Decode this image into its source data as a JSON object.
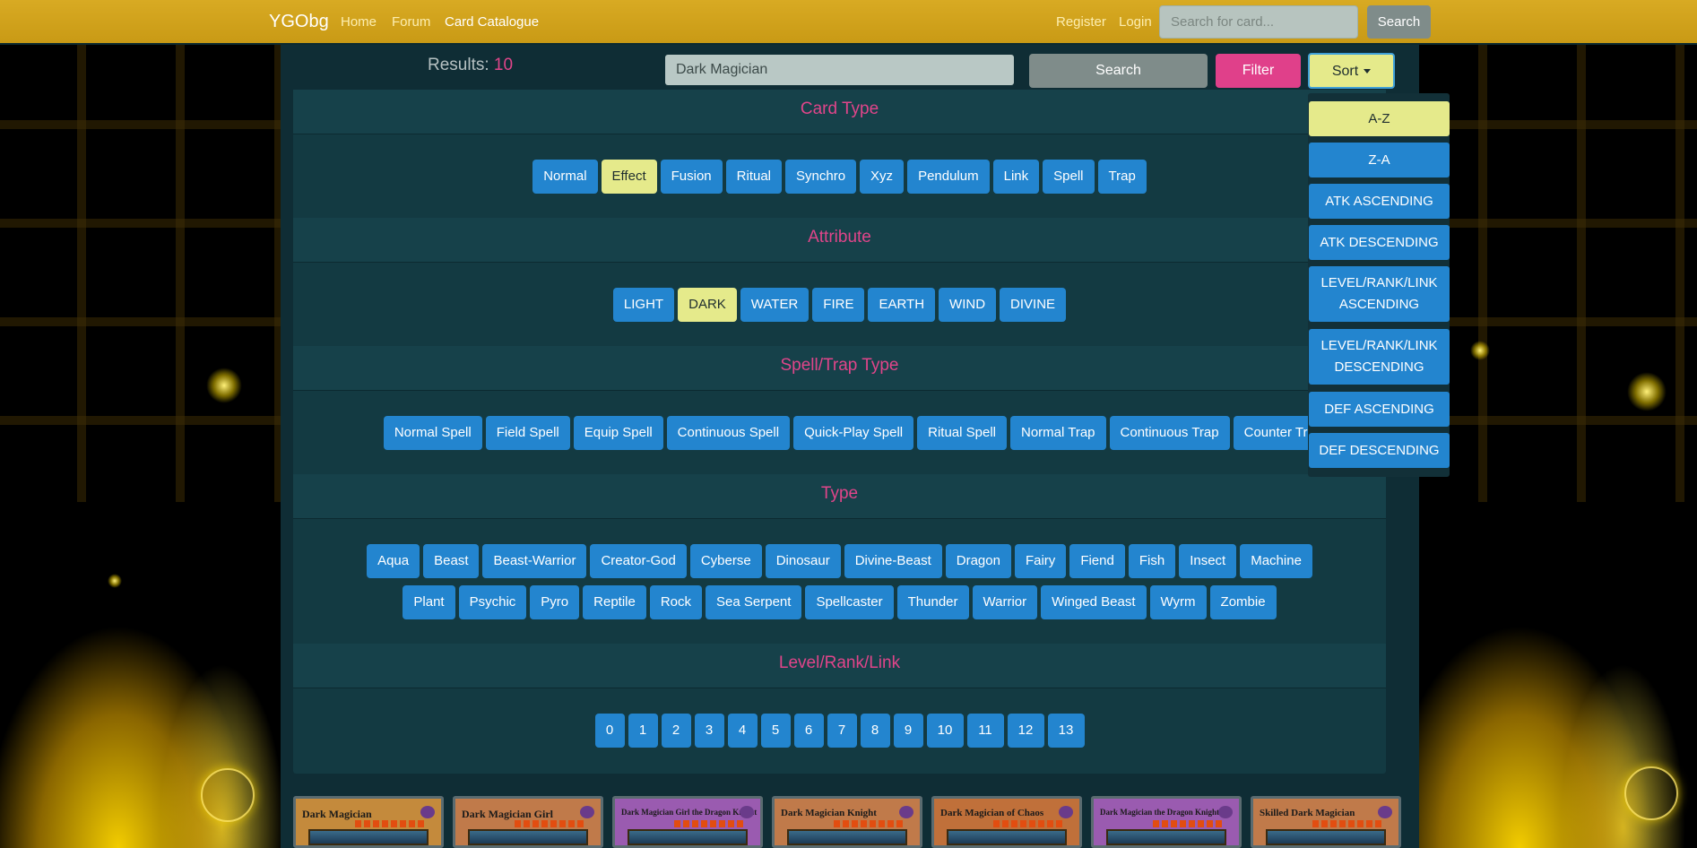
{
  "navbar": {
    "brand": "YGObg",
    "links": [
      "Home",
      "Forum",
      "Card Catalogue"
    ],
    "register": "Register",
    "login": "Login",
    "search_placeholder": "Search for card...",
    "search_button": "Search"
  },
  "toolbar": {
    "results_label": "Results:",
    "results_count": "10",
    "search_value": "Dark Magician",
    "search_button": "Search",
    "filter_button": "Filter",
    "sort_button": "Sort"
  },
  "filters": {
    "card_type": {
      "title": "Card Type",
      "options": [
        "Normal",
        "Effect",
        "Fusion",
        "Ritual",
        "Synchro",
        "Xyz",
        "Pendulum",
        "Link",
        "Spell",
        "Trap"
      ],
      "selected": "Effect"
    },
    "attribute": {
      "title": "Attribute",
      "options": [
        "LIGHT",
        "DARK",
        "WATER",
        "FIRE",
        "EARTH",
        "WIND",
        "DIVINE"
      ],
      "selected": "DARK"
    },
    "spell_trap_type": {
      "title": "Spell/Trap Type",
      "options": [
        "Normal Spell",
        "Field Spell",
        "Equip Spell",
        "Continuous Spell",
        "Quick-Play Spell",
        "Ritual Spell",
        "Normal Trap",
        "Continuous Trap",
        "Counter Trap"
      ]
    },
    "type": {
      "title": "Type",
      "row1": [
        "Aqua",
        "Beast",
        "Beast-Warrior",
        "Creator-God",
        "Cyberse",
        "Dinosaur",
        "Divine-Beast",
        "Dragon",
        "Fairy",
        "Fiend",
        "Fish",
        "Insect",
        "Machine"
      ],
      "row2": [
        "Plant",
        "Psychic",
        "Pyro",
        "Reptile",
        "Rock",
        "Sea Serpent",
        "Spellcaster",
        "Thunder",
        "Warrior",
        "Winged Beast",
        "Wyrm",
        "Zombie"
      ]
    },
    "level": {
      "title": "Level/Rank/Link",
      "options": [
        "0",
        "1",
        "2",
        "3",
        "4",
        "5",
        "6",
        "7",
        "8",
        "9",
        "10",
        "11",
        "12",
        "13"
      ]
    }
  },
  "sort_menu": {
    "items": [
      "A-Z",
      "Z-A",
      "ATK ASCENDING",
      "ATK DESCENDING",
      "LEVEL/RANK/LINK ASCENDING",
      "LEVEL/RANK/LINK DESCENDING",
      "DEF ASCENDING",
      "DEF DESCENDING"
    ],
    "selected": "A-Z"
  },
  "cards": [
    {
      "name": "Dark Magician",
      "frame": "#c48a3c"
    },
    {
      "name": "Dark Magician Girl",
      "frame": "#c07a4a"
    },
    {
      "name": "Dark Magician Girl the Dragon Knight",
      "frame": "#9a5bb0"
    },
    {
      "name": "Dark Magician Knight",
      "frame": "#c07a4a"
    },
    {
      "name": "Dark Magician of Chaos",
      "frame": "#c0703a"
    },
    {
      "name": "Dark Magician the Dragon Knight",
      "frame": "#9a5bb0"
    },
    {
      "name": "Skilled Dark Magician",
      "frame": "#c07a4a"
    }
  ]
}
